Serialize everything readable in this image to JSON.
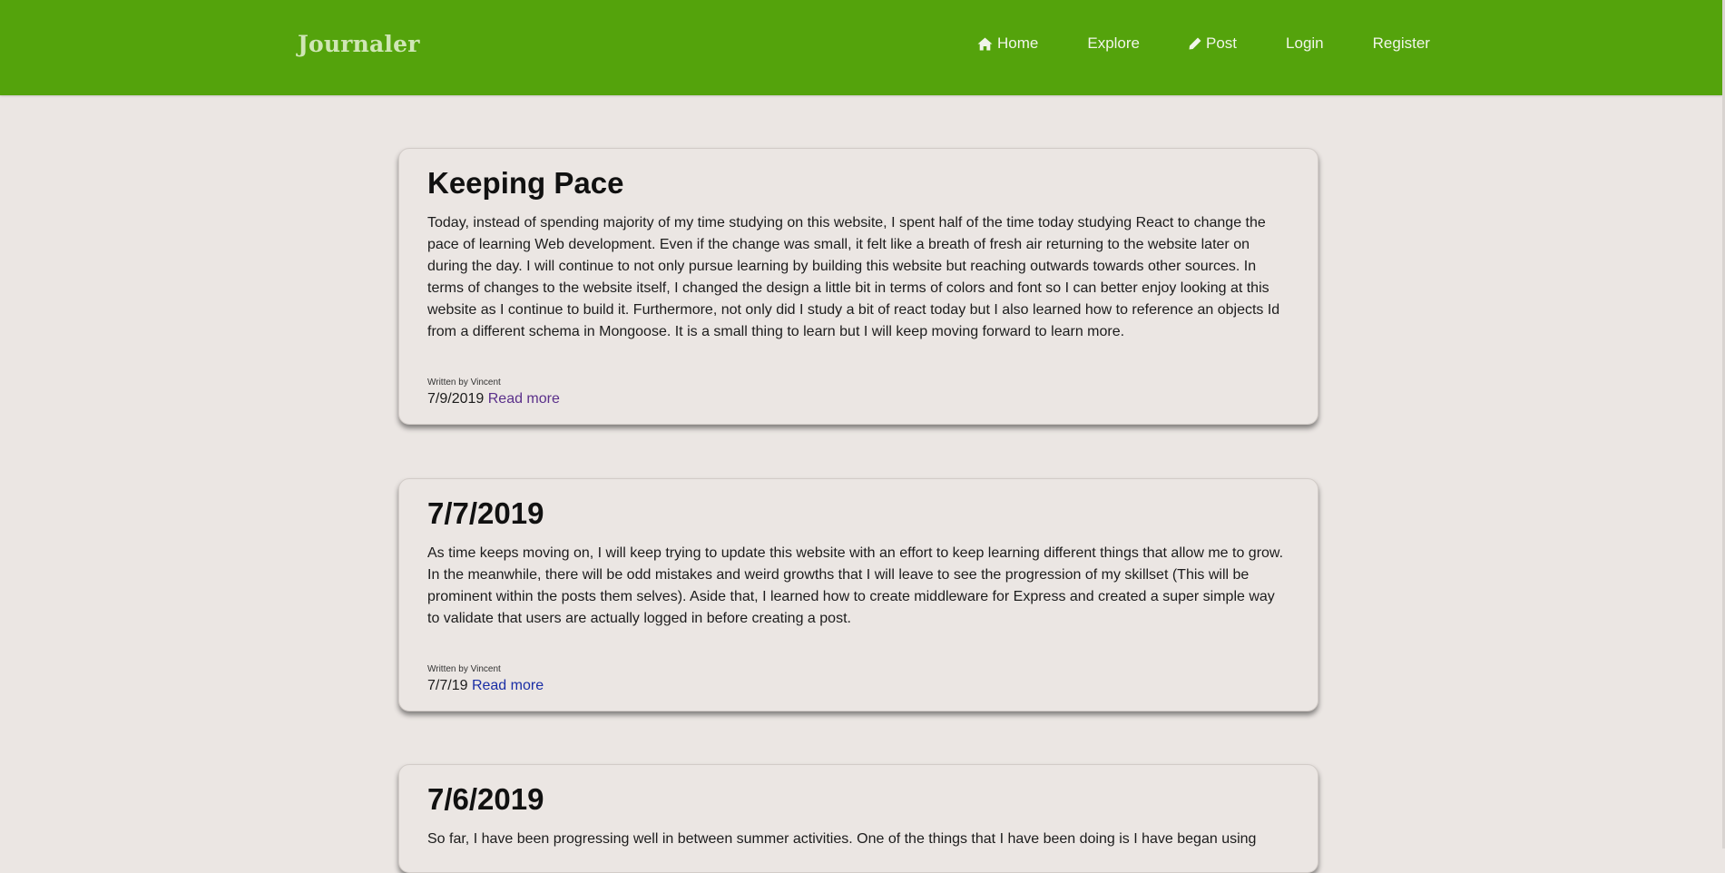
{
  "nav": {
    "brand": "Journaler",
    "links": [
      {
        "label": "Home",
        "icon": "home-icon"
      },
      {
        "label": "Explore"
      },
      {
        "label": "Post",
        "icon": "pencil-icon"
      },
      {
        "label": "Login"
      },
      {
        "label": "Register"
      }
    ]
  },
  "colors": {
    "navbar": "#54a30c",
    "background": "#ebe6e3",
    "link_visited": "#5a2f8a",
    "link": "#1a2ea5"
  },
  "posts": [
    {
      "title": "Keeping Pace",
      "body": "Today, instead of spending majority of my time studying on this website, I spent half of the time today studying React to change the pace of learning Web development. Even if the change was small, it felt like a breath of fresh air returning to the website later on during the day. I will continue to not only pursue learning by building this website but reaching outwards towards other sources. In terms of changes to the website itself, I changed the design a little bit in terms of colors and font so I can better enjoy looking at this website as I continue to build it. Furthermore, not only did I study a bit of react today but I also learned how to reference an objects Id from a different schema in Mongoose. It is a small thing to learn but I will keep moving forward to learn more.",
      "byline": "Written by Vincent",
      "date": "7/9/2019",
      "read_more": "Read more"
    },
    {
      "title": "7/7/2019",
      "body": "As time keeps moving on, I will keep trying to update this website with an effort to keep learning different things that allow me to grow. In the meanwhile, there will be odd mistakes and weird growths that I will leave to see the progression of my skillset (This will be prominent within the posts them selves). Aside that, I learned how to create middleware for Express and created a super simple way to validate that users are actually logged in before creating a post.",
      "byline": "Written by Vincent",
      "date": "7/7/19",
      "read_more": "Read more"
    },
    {
      "title": "7/6/2019",
      "body": "So far, I have been progressing well in between summer activities. One of the things that I have been doing is I have began using"
    }
  ]
}
